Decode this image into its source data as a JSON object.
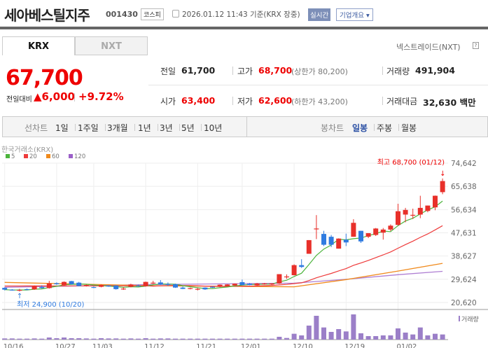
{
  "header": {
    "title": "세아베스틸지주",
    "code": "001430",
    "market": "코스피",
    "time": "2026.01.12 11:43 기준(KRX 장중)",
    "realtime": "실시간",
    "company": "기업개요 ▾"
  },
  "tabs": {
    "krx": "KRX",
    "nxt": "NXT",
    "nxt_label": "넥스트레이드(NXT)",
    "help": "?"
  },
  "quote": {
    "price": "67,700",
    "change_label": "전일대비",
    "change": "▲6,000",
    "pct": "+9.72%",
    "prev_label": "전일",
    "prev": "61,700",
    "high_label": "고가",
    "high": "68,700",
    "upper": "(상한가 80,200)",
    "vol_label": "거래량",
    "vol": "491,904",
    "open_label": "시가",
    "open": "63,400",
    "low_label": "저가",
    "low": "62,600",
    "lower": "(하한가 43,200)",
    "amt_label": "거래대금",
    "amt": "32,630 백만"
  },
  "toolbar": {
    "line_label": "선차트",
    "line": [
      "1일",
      "1주일",
      "3개월",
      "1년",
      "3년",
      "5년",
      "10년"
    ],
    "candle_label": "봉차트",
    "candle": [
      "일봉",
      "주봉",
      "월봉"
    ],
    "active": "일봉"
  },
  "chart_data": {
    "type": "candlestick",
    "source": "한국거래소(KRX)",
    "legend": [
      {
        "name": "5",
        "color": "#4cb43c"
      },
      {
        "name": "20",
        "color": "#ee3b3b"
      },
      {
        "name": "60",
        "color": "#f08a1c"
      },
      {
        "name": "120",
        "color": "#9b5fc8"
      }
    ],
    "yticks": [
      "74,642",
      "65,638",
      "56,634",
      "47,631",
      "38,627",
      "29,624",
      "20,620"
    ],
    "ylim": [
      20620,
      74642
    ],
    "xticks": [
      {
        "i": 0,
        "label": "10/16"
      },
      {
        "i": 7,
        "label": "10/27"
      },
      {
        "i": 12,
        "label": "11/03"
      },
      {
        "i": 19,
        "label": "11/12"
      },
      {
        "i": 26,
        "label": "11/21"
      },
      {
        "i": 32,
        "label": "12/01"
      },
      {
        "i": 39,
        "label": "12/10"
      },
      {
        "i": 46,
        "label": "12/19"
      },
      {
        "i": 53,
        "label": "01/02"
      }
    ],
    "max_label": "최고 68,700 (01/12)",
    "min_label": "최저 24,900 (10/20)",
    "volume_label": "거래량",
    "ohlc": [
      [
        26300,
        26500,
        25300,
        25600
      ],
      [
        25600,
        25800,
        25200,
        25300
      ],
      [
        25300,
        25900,
        24900,
        25500
      ],
      [
        25800,
        26000,
        25400,
        25500
      ],
      [
        25700,
        27200,
        25500,
        27000
      ],
      [
        26600,
        27300,
        26000,
        26200
      ],
      [
        26200,
        29000,
        26000,
        28000
      ],
      [
        28100,
        28400,
        27500,
        27700
      ],
      [
        27300,
        28800,
        27100,
        28600
      ],
      [
        28900,
        29000,
        27600,
        27700
      ],
      [
        28300,
        28600,
        26900,
        27000
      ],
      [
        27000,
        27600,
        26800,
        27400
      ],
      [
        26600,
        26800,
        26200,
        26400
      ],
      [
        26700,
        27600,
        26500,
        27400
      ],
      [
        27200,
        27300,
        26700,
        26800
      ],
      [
        27200,
        27300,
        25600,
        25800
      ],
      [
        25900,
        26600,
        25500,
        26000
      ],
      [
        26700,
        27900,
        26500,
        27600
      ],
      [
        27200,
        27500,
        26800,
        26900
      ],
      [
        26900,
        28700,
        26800,
        28600
      ],
      [
        28200,
        29000,
        27800,
        28300
      ],
      [
        28400,
        29300,
        27400,
        27600
      ],
      [
        27800,
        28400,
        27000,
        27500
      ],
      [
        27700,
        27900,
        26300,
        26400
      ],
      [
        26400,
        26800,
        25800,
        25900
      ],
      [
        26000,
        26400,
        25700,
        26200
      ],
      [
        25800,
        26300,
        25300,
        25900
      ],
      [
        26400,
        26500,
        25500,
        25700
      ],
      [
        26700,
        26900,
        26300,
        26400
      ],
      [
        26700,
        27600,
        26500,
        27500
      ],
      [
        27000,
        27700,
        26800,
        27600
      ],
      [
        27200,
        28000,
        27000,
        27900
      ],
      [
        28500,
        29500,
        27400,
        27400
      ],
      [
        27900,
        28200,
        27300,
        27400
      ],
      [
        27300,
        28200,
        27100,
        28000
      ],
      [
        27700,
        28200,
        27500,
        28000
      ],
      [
        27600,
        28100,
        27400,
        28000
      ],
      [
        28000,
        31600,
        27800,
        31600
      ],
      [
        30500,
        31500,
        29800,
        30700
      ],
      [
        31200,
        35400,
        31100,
        35100
      ],
      [
        35100,
        37400,
        34000,
        34400
      ],
      [
        39500,
        44800,
        39500,
        44800
      ],
      [
        49100,
        54500,
        45200,
        49300
      ],
      [
        47200,
        48400,
        42500,
        43000
      ],
      [
        46100,
        46800,
        42100,
        43000
      ],
      [
        41500,
        45500,
        41500,
        45400
      ],
      [
        45000,
        47300,
        42500,
        43900
      ],
      [
        46100,
        52900,
        46100,
        51500
      ],
      [
        48400,
        48400,
        43700,
        44300
      ],
      [
        46100,
        47400,
        45600,
        47500
      ],
      [
        46800,
        49500,
        46400,
        49300
      ],
      [
        47700,
        49500,
        45000,
        48900
      ],
      [
        48900,
        50900,
        48300,
        50400
      ],
      [
        50700,
        58900,
        50400,
        56000
      ],
      [
        54700,
        57300,
        51700,
        56500
      ],
      [
        54300,
        57000,
        53000,
        54600
      ],
      [
        54700,
        62000,
        53300,
        57300
      ],
      [
        56100,
        58200,
        55600,
        58200
      ],
      [
        57500,
        62100,
        56400,
        62000
      ],
      [
        63400,
        68700,
        62600,
        67700
      ]
    ],
    "volume": [
      5,
      5,
      4,
      4,
      5,
      4,
      9,
      6,
      9,
      6,
      6,
      5,
      4,
      6,
      5,
      5,
      4,
      5,
      4,
      6,
      4,
      5,
      5,
      4,
      4,
      4,
      4,
      4,
      4,
      4,
      4,
      4,
      4,
      4,
      4,
      4,
      4,
      12,
      7,
      25,
      18,
      60,
      102,
      52,
      33,
      45,
      35,
      108,
      27,
      15,
      15,
      18,
      18,
      48,
      30,
      22,
      52,
      18,
      25,
      22
    ],
    "ma60": [
      [
        0,
        28400
      ],
      [
        20,
        27100
      ],
      [
        39,
        26700
      ],
      [
        46,
        29500
      ],
      [
        53,
        32800
      ],
      [
        59,
        35800
      ]
    ],
    "ma120": [
      [
        0,
        26500
      ],
      [
        20,
        27600
      ],
      [
        39,
        28100
      ],
      [
        46,
        29600
      ],
      [
        53,
        31400
      ],
      [
        59,
        32700
      ]
    ]
  }
}
